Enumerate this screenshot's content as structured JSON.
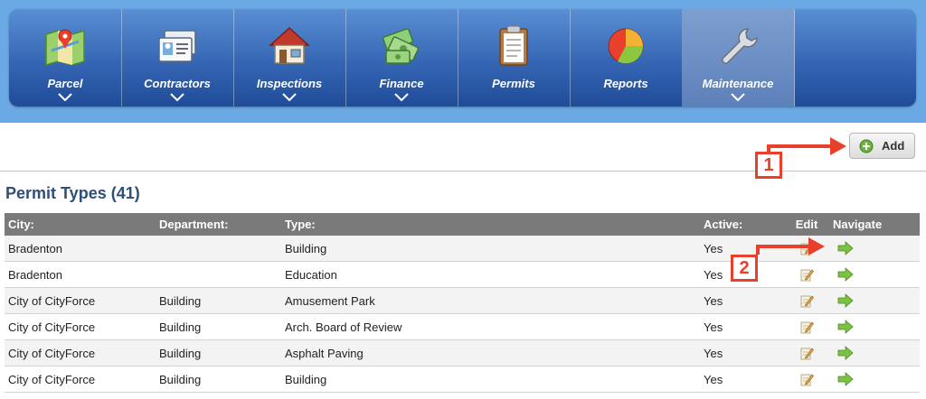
{
  "nav": {
    "items": [
      {
        "label": "Parcel",
        "icon": "map-pin-icon",
        "has_dropdown": true
      },
      {
        "label": "Contractors",
        "icon": "id-card-icon",
        "has_dropdown": true
      },
      {
        "label": "Inspections",
        "icon": "house-icon",
        "has_dropdown": true
      },
      {
        "label": "Finance",
        "icon": "money-icon",
        "has_dropdown": true
      },
      {
        "label": "Permits",
        "icon": "clipboard-icon",
        "has_dropdown": false
      },
      {
        "label": "Reports",
        "icon": "pie-chart-icon",
        "has_dropdown": false
      },
      {
        "label": "Maintenance",
        "icon": "wrench-icon",
        "has_dropdown": true,
        "active": true
      }
    ]
  },
  "toolbar": {
    "add_label": "Add"
  },
  "page": {
    "title": "Permit Types (41)"
  },
  "table": {
    "headers": {
      "city": "City:",
      "department": "Department:",
      "type": "Type:",
      "active": "Active:",
      "edit": "Edit",
      "navigate": "Navigate"
    },
    "rows": [
      {
        "city": "Bradenton",
        "department": "",
        "type": "Building",
        "active": "Yes"
      },
      {
        "city": "Bradenton",
        "department": "",
        "type": "Education",
        "active": "Yes"
      },
      {
        "city": "City of CityForce",
        "department": "Building",
        "type": "Amusement Park",
        "active": "Yes"
      },
      {
        "city": "City of CityForce",
        "department": "Building",
        "type": "Arch. Board of Review",
        "active": "Yes"
      },
      {
        "city": "City of CityForce",
        "department": "Building",
        "type": "Asphalt Paving",
        "active": "Yes"
      },
      {
        "city": "City of CityForce",
        "department": "Building",
        "type": "Building",
        "active": "Yes"
      }
    ]
  },
  "callouts": {
    "one": "1",
    "two": "2"
  },
  "colors": {
    "nav_top": "#5a8fd4",
    "nav_bottom": "#1f4c98",
    "title": "#2e4f78",
    "header_bg": "#7a7a7a",
    "callout": "#e8402a",
    "arrow_green": "#7cc242"
  }
}
